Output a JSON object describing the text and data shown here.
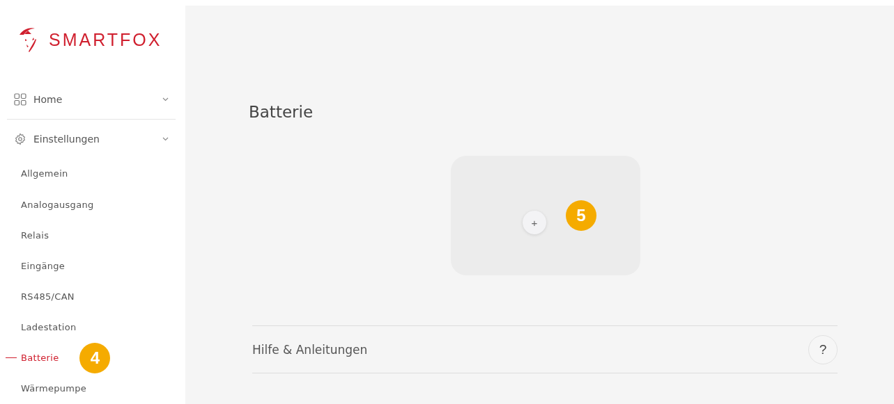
{
  "logo": {
    "text": "SMARTFOX"
  },
  "nav": [
    {
      "label": "Home",
      "kind": "grid",
      "expanded": false
    },
    {
      "label": "Einstellungen",
      "kind": "gear",
      "expanded": true,
      "children": [
        {
          "label": "Allgemein",
          "selected": false
        },
        {
          "label": "Analogausgang",
          "selected": false
        },
        {
          "label": "Relais",
          "selected": false
        },
        {
          "label": "Eingänge",
          "selected": false
        },
        {
          "label": "RS485/CAN",
          "selected": false
        },
        {
          "label": "Ladestation",
          "selected": false
        },
        {
          "label": "Batterie",
          "selected": true,
          "marker": "4"
        },
        {
          "label": "Wärmepumpe",
          "selected": false
        }
      ]
    }
  ],
  "page": {
    "title": "Batterie",
    "add_button": {
      "label": "+",
      "marker": "5"
    },
    "help": {
      "label": "Hilfe & Anleitungen",
      "button": "?"
    }
  }
}
